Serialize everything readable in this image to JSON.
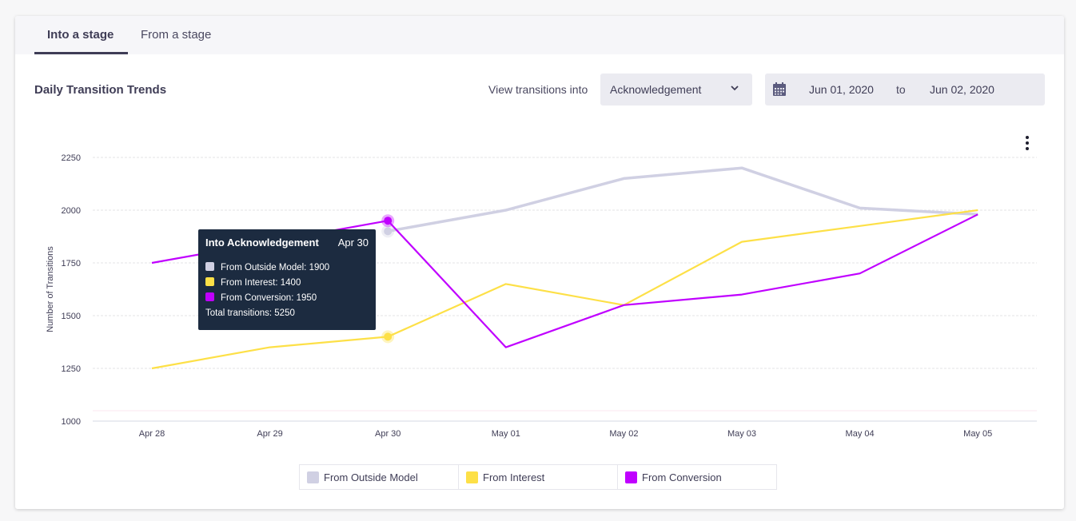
{
  "tabs": [
    {
      "label": "Into a stage",
      "active": true
    },
    {
      "label": "From a stage",
      "active": false
    }
  ],
  "header": {
    "title": "Daily Transition Trends",
    "view_label": "View transitions into",
    "stage_select": "Acknowledgement",
    "date_from": "Jun 01, 2020",
    "date_sep": "to",
    "date_to": "Jun 02, 2020"
  },
  "icons": {
    "calendar": "calendar-icon",
    "chevron": "chevron-down-icon",
    "menu": "kebab-menu-icon"
  },
  "tooltip": {
    "title": "Into Acknowledgement",
    "date": "Apr 30",
    "rows": [
      {
        "label": "From Outside Model: 1900",
        "color": "#d0d0e3"
      },
      {
        "label": "From Interest: 1400",
        "color": "#fde047"
      },
      {
        "label": "From Conversion: 1950",
        "color": "#c000ff"
      }
    ],
    "total": "Total transitions: 5250"
  },
  "chart_data": {
    "type": "line",
    "title": "Daily Transition Trends",
    "xlabel": "",
    "ylabel": "Number of Transitions",
    "categories": [
      "Apr 28",
      "Apr 29",
      "Apr 30",
      "May 01",
      "May 02",
      "May 03",
      "May 04",
      "May 05"
    ],
    "yticks": [
      "1000",
      "1250",
      "1500",
      "1750",
      "2000",
      "2250"
    ],
    "ylim": [
      1000,
      2300
    ],
    "grid": true,
    "legend_position": "bottom-center",
    "series": [
      {
        "name": "From Outside Model",
        "color": "#d0d0e3",
        "values": [
          null,
          null,
          1900,
          2000,
          2150,
          2200,
          2010,
          1980
        ]
      },
      {
        "name": "From Interest",
        "color": "#fde047",
        "values": [
          1250,
          1350,
          1400,
          1650,
          1550,
          1850,
          1925,
          2000
        ]
      },
      {
        "name": "From Conversion",
        "color": "#c000ff",
        "values": [
          1750,
          1850,
          1950,
          1350,
          1550,
          1600,
          1700,
          1980
        ]
      }
    ],
    "highlighted_category": "Apr 30"
  }
}
